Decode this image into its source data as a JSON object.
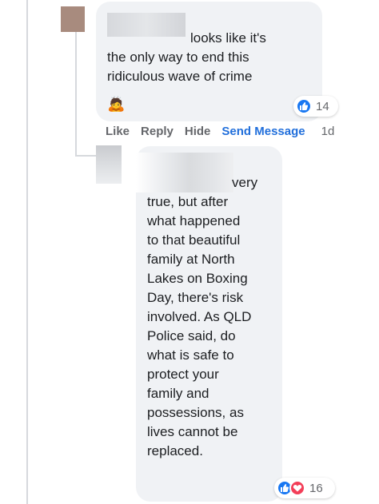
{
  "comments": [
    {
      "author_name": "",
      "text": "looks like it's\nthe only way to end this\nridiculous wave of crime",
      "emoji": "🙇",
      "reactions": {
        "types": [
          "like-icon"
        ],
        "count": "14"
      },
      "actions": {
        "like": "Like",
        "reply": "Reply",
        "hide": "Hide",
        "send_message": "Send Message",
        "time": "1d"
      }
    },
    {
      "author_name": "",
      "text": "very\ntrue, but after\nwhat happened\nto that beautiful\nfamily at North\nLakes on Boxing\nDay, there's risk\ninvolved. As QLD\nPolice said, do\nwhat is safe to\nprotect your\nfamily and\npossessions, as\nlives cannot be\nreplaced.",
      "reactions": {
        "types": [
          "like-icon",
          "heart-icon"
        ],
        "count": "16"
      }
    }
  ],
  "colors": {
    "bubble": "#f0f2f5",
    "link": "#216fdb",
    "meta": "#65676b",
    "like": "#1877f2",
    "love": "#f33e58"
  }
}
